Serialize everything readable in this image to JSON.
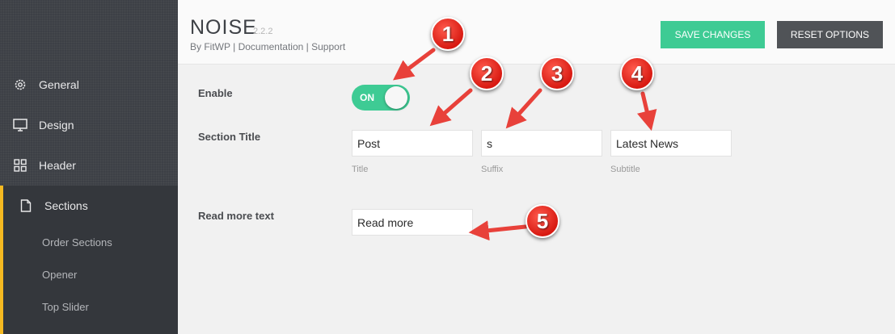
{
  "sidebar": {
    "items": [
      {
        "label": "General",
        "icon": "gear-icon"
      },
      {
        "label": "Design",
        "icon": "monitor-icon"
      },
      {
        "label": "Header",
        "icon": "grid-icon"
      },
      {
        "label": "Sections",
        "icon": "document-icon"
      }
    ],
    "sub_items": [
      "Order Sections",
      "Opener",
      "Top Slider"
    ]
  },
  "header": {
    "title": "NOISE",
    "version": "2.2.2",
    "by": "By FitWP",
    "sep1": "|",
    "documentation": "Documentation",
    "sep2": "|",
    "support": "Support",
    "save_label": "SAVE CHANGES",
    "reset_label": "RESET OPTIONS"
  },
  "form": {
    "enable_label": "Enable",
    "toggle_text": "ON",
    "section_title_label": "Section Title",
    "title_value": "Post",
    "title_hint": "Title",
    "suffix_value": "s",
    "suffix_hint": "Suffix",
    "subtitle_value": "Latest News",
    "subtitle_hint": "Subtitle",
    "read_more_label": "Read more text",
    "read_more_value": "Read more"
  },
  "annotations": [
    "1",
    "2",
    "3",
    "4",
    "5"
  ],
  "colors": {
    "accent_green": "#3ecb94",
    "sidebar_bg": "#3a3d43",
    "active_marker": "#f5b921",
    "annotation_red": "#d81a12"
  }
}
